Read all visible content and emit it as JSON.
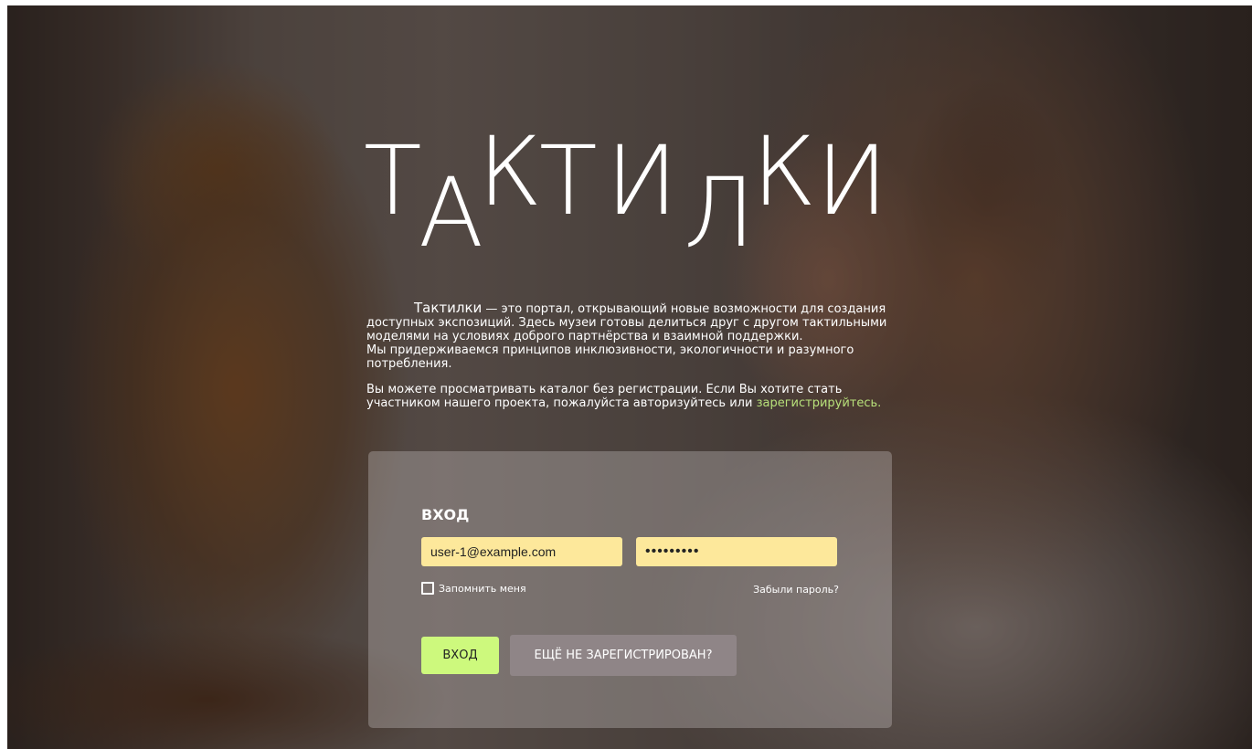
{
  "logo": {
    "letters": [
      "Т",
      "А",
      "К",
      "Т",
      "И",
      "Л",
      "К",
      "И"
    ],
    "text": "ТАКТИЛКИ"
  },
  "intro": {
    "brand": "Тактилки",
    "paragraph1": " — это портал, открывающий новые возможности для создания доступных экспозиций. Здесь музеи готовы делиться друг с другом тактильными моделями на условиях доброго партнёрства и взаимной поддержки.",
    "paragraph2": "Мы придерживаемся принципов инклюзивности, экологичности и разумного потребления.",
    "paragraph3": "Вы можете просматривать каталог без регистрации. Если Вы хотите стать участником нашего проекта, пожалуйста авторизуйтесь или ",
    "register_link": "зарегистрируйтесь."
  },
  "login": {
    "title": "ВХОД",
    "email_value": "user-1@example.com",
    "password_value": "•••••••••",
    "remember_label": "Запомнить меня",
    "forgot_label": "Забыли пароль?",
    "login_button": "ВХОД",
    "register_button": "ЕЩЁ НЕ ЗАРЕГИСТРИРОВАН?"
  },
  "colors": {
    "accent_green": "#cdf97d",
    "link_green": "#b7e07a",
    "input_yellow": "#fde89b",
    "secondary_button": "#8f8587"
  }
}
